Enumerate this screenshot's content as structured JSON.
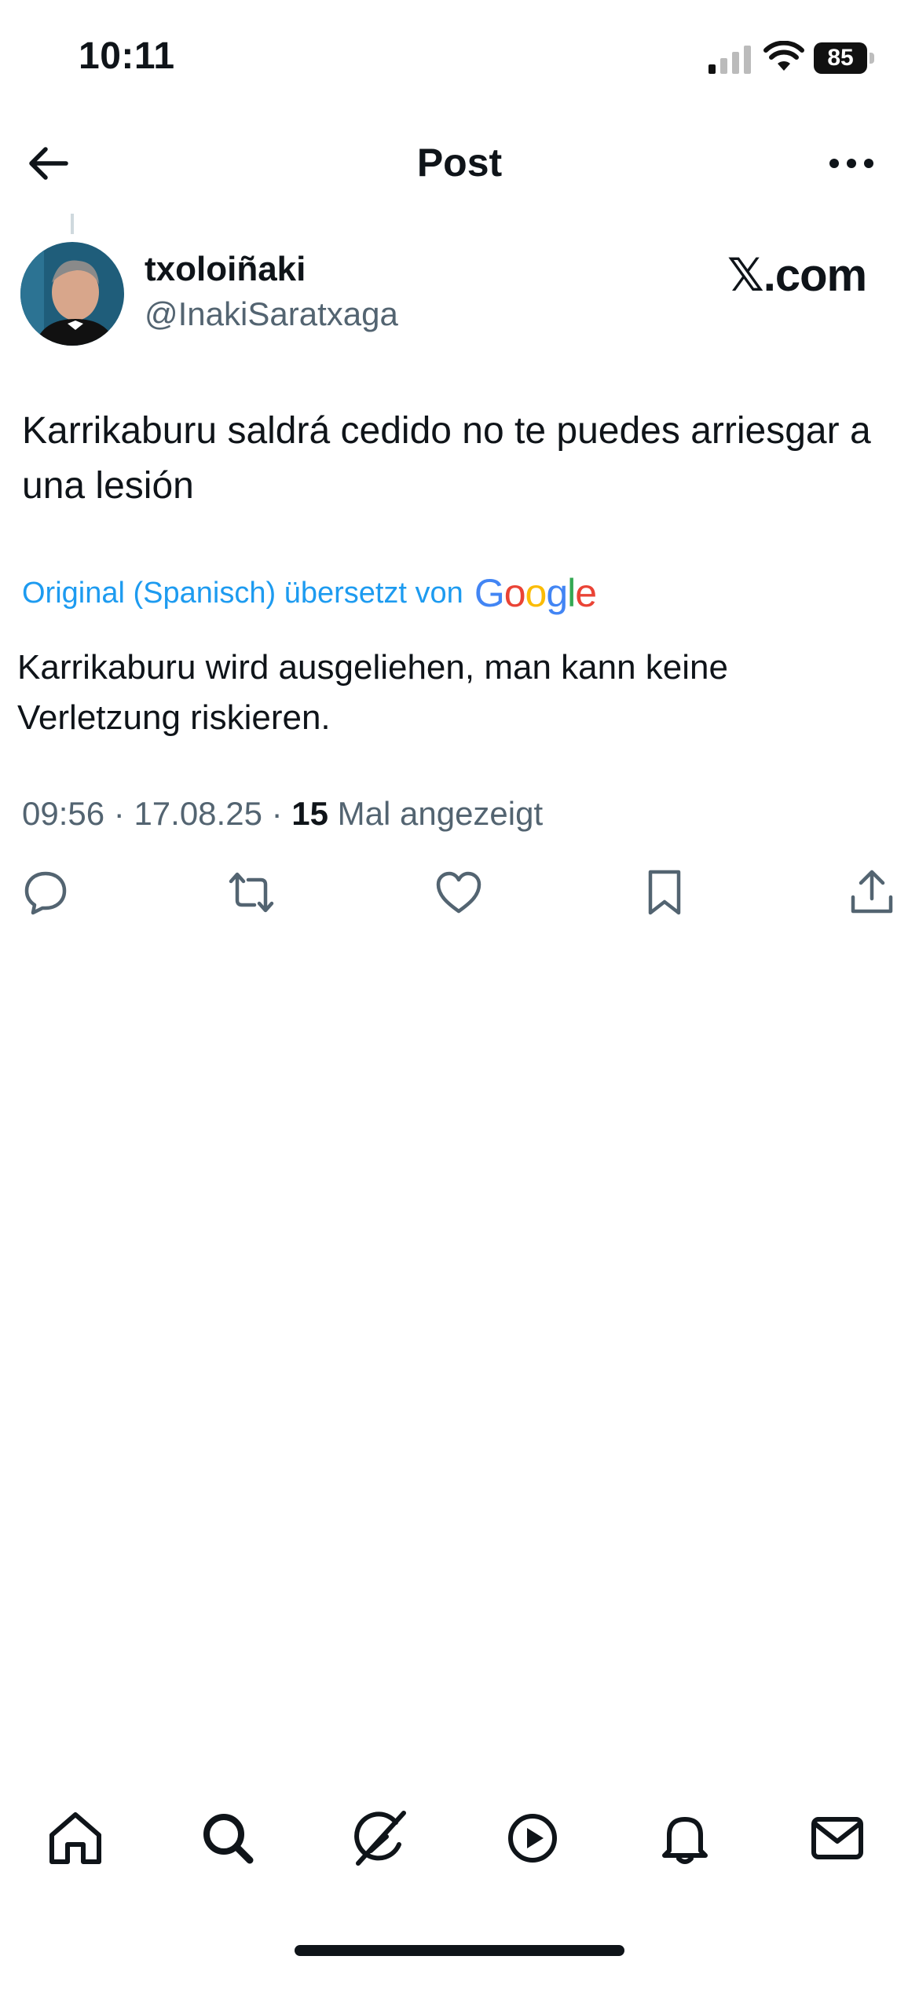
{
  "status_bar": {
    "time": "10:11",
    "battery": "85",
    "icons": [
      "signal-icon",
      "wifi-icon",
      "battery-icon"
    ]
  },
  "header": {
    "title": "Post",
    "back_icon": "arrow-left-icon",
    "more_icon": "more-horizontal-icon"
  },
  "post": {
    "display_name": "txoloiñaki",
    "handle": "@InakiSaratxaga",
    "brand": "𝕏.com",
    "text": "Karrikaburu saldrá cedido no te puedes arriesgar a una lesión",
    "translation_label": "Original (Spanisch) übersetzt von",
    "translation_provider": "Google",
    "translated_text": "Karrikaburu wird ausgeliehen, man kann keine Verletzung riskieren.",
    "time": "09:56",
    "date": "17.08.25",
    "views_count": "15",
    "views_label": "Mal angezeigt"
  },
  "actions": [
    "reply-icon",
    "repost-icon",
    "like-icon",
    "bookmark-icon",
    "share-icon"
  ],
  "tabbar": [
    "home-icon",
    "search-icon",
    "grok-icon",
    "video-icon",
    "notifications-icon",
    "messages-icon"
  ],
  "colors": {
    "text": "#0f1419",
    "secondary": "#536471",
    "link": "#1d9bf0",
    "google_blue": "#4285F4",
    "google_red": "#EA4335",
    "google_yellow": "#FBBC05",
    "google_green": "#34A853"
  }
}
